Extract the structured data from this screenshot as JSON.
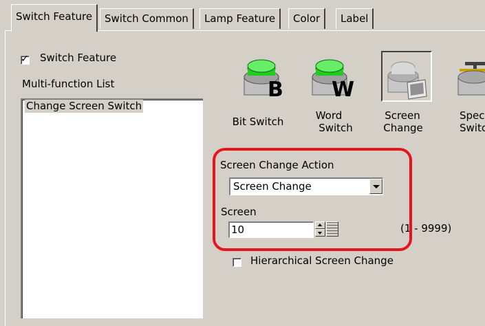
{
  "tabs": [
    {
      "label": "Switch Feature",
      "active": true
    },
    {
      "label": "Switch Common",
      "active": false
    },
    {
      "label": "Lamp Feature",
      "active": false
    },
    {
      "label": "Color",
      "active": false
    },
    {
      "label": "Label",
      "active": false
    }
  ],
  "switch_feature": {
    "label": "Switch Feature",
    "checked": true
  },
  "multi_function": {
    "label": "Multi-function List",
    "items": [
      "Change Screen Switch"
    ]
  },
  "icon_buttons": [
    {
      "label_1": "Bit Switch",
      "label_2": "",
      "icon": "green-button-B-icon"
    },
    {
      "label_1": "Word",
      "label_2": "Switch",
      "icon": "green-button-W-icon"
    },
    {
      "label_1": "Screen",
      "label_2": "Change",
      "icon": "screen-change-icon"
    },
    {
      "label_1": "Spec",
      "label_2": "Switc",
      "icon": "special-switch-icon"
    }
  ],
  "screen_change_action": {
    "label": "Screen Change Action",
    "value": "Screen Change"
  },
  "screen": {
    "label": "Screen",
    "value": "10",
    "range": "(1 - 9999)"
  },
  "hierarchical": {
    "label": "Hierarchical Screen Change",
    "checked": false
  },
  "colors": {
    "face": "#d4d0c8",
    "highlight_ring": "#e8141c",
    "button_green": "#22cc22"
  }
}
